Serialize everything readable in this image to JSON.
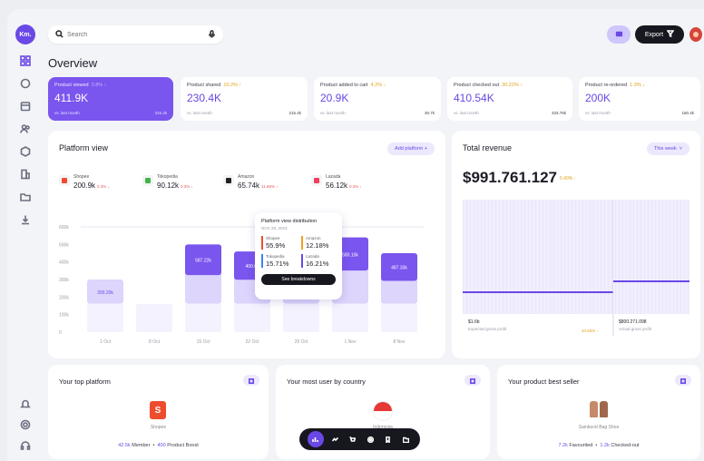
{
  "brand": {
    "logo_text": "Km.",
    "accent": "#6a48e6"
  },
  "search": {
    "placeholder": "Search"
  },
  "header": {
    "export_label": "Export"
  },
  "page": {
    "title": "Overview"
  },
  "stats": [
    {
      "label": "Product viewed",
      "delta": "3.8% ↑",
      "value": "411.9K",
      "foot_label": "vs. last month",
      "foot_value": "315.3k"
    },
    {
      "label": "Product shared",
      "delta": "10.2% ↑",
      "value": "230.4K",
      "foot_label": "vs. last month",
      "foot_value": "215.4k"
    },
    {
      "label": "Product added to cart",
      "delta": "4.2% ↓",
      "value": "20.9K",
      "foot_label": "vs. last month",
      "foot_value": "30.7k"
    },
    {
      "label": "Product checked out",
      "delta": "30.22% ↑",
      "value": "410.54K",
      "foot_label": "vs. last month",
      "foot_value": "333.78k"
    },
    {
      "label": "Product re-ordered",
      "delta": "1.3% ↓",
      "value": "200K",
      "foot_label": "vs. last month",
      "foot_value": "180.4k"
    }
  ],
  "platform_view": {
    "title": "Platform view",
    "add_label": "Add platform +",
    "platforms": [
      {
        "name": "Shopee",
        "value": "200.9k",
        "delta": "0.3% ↓",
        "color": "#ee4d2d"
      },
      {
        "name": "Tokopedia",
        "value": "90.12k",
        "delta": "0.3% ↓",
        "color": "#42b549"
      },
      {
        "name": "Amazon",
        "value": "65.74k",
        "delta": "11.66% ↑",
        "color": "#222222"
      },
      {
        "name": "Lazada",
        "value": "56.12k",
        "delta": "0.3% ↓",
        "color": "#f0405a"
      }
    ]
  },
  "tooltip": {
    "title": "Platform view distribution",
    "date": "NOV 29, 2023",
    "items": [
      {
        "name": "Shopee",
        "value": "55.9%",
        "color": "#ee4d2d"
      },
      {
        "name": "Amazon",
        "value": "12.18%",
        "color": "#f0a020"
      },
      {
        "name": "Tokopedia",
        "value": "15.71%",
        "color": "#3b82f6"
      },
      {
        "name": "Lazada",
        "value": "16.21%",
        "color": "#6a48e6"
      }
    ],
    "button_label": "See breakdowns"
  },
  "chart_data": {
    "type": "bar",
    "stacked": true,
    "y_ticks": [
      "600k",
      "500k",
      "400k",
      "300k",
      "200k",
      "100k",
      "0"
    ],
    "ylim": [
      0,
      600
    ],
    "categories": [
      "1 Oct",
      "8 Oct",
      "15 Oct",
      "22 Oct",
      "29 Oct",
      "5 Nov",
      "12 Nov",
      "19 Nov"
    ],
    "x_tick_labels": [
      "1 Oct",
      "8 Oct",
      "15 Oct",
      "22 Oct",
      "29 Oct",
      "1 Nov",
      "8 Nov"
    ],
    "totals": [
      300,
      160,
      500,
      460,
      510,
      540,
      450
    ],
    "data_labels": [
      "300.20k",
      "",
      "587.22k",
      "400.0k",
      "",
      "580.10k",
      "487.33k"
    ],
    "colors": {
      "top": "#7a55ee",
      "mid": "#ddd5fc",
      "low": "#eeeafd",
      "base": "#f4f2fe"
    }
  },
  "total_revenue": {
    "title": "Total revenue",
    "period_label": "This week",
    "value": "$991.761.127",
    "delta": "5.40% ↑",
    "left": {
      "value": "$1.6b",
      "label": "Expected gross profit",
      "change": "40.65% ↑"
    },
    "right": {
      "value": "$800.271.098",
      "label": "Actual gross profit"
    }
  },
  "top_platform": {
    "title": "Your top platform",
    "name": "Shopee",
    "members": "42.5k",
    "members_label": "Member",
    "boost": "400",
    "boost_label": "Product Boost"
  },
  "top_country": {
    "title": "Your most user by country",
    "name": "Indonesia"
  },
  "best_seller": {
    "title": "Your product best seller",
    "name": "Sainburst Bag Shoe",
    "favourited": "7.2k",
    "favourited_label": "Favourited",
    "checked": "1.2k",
    "checked_label": "Checked-out"
  }
}
